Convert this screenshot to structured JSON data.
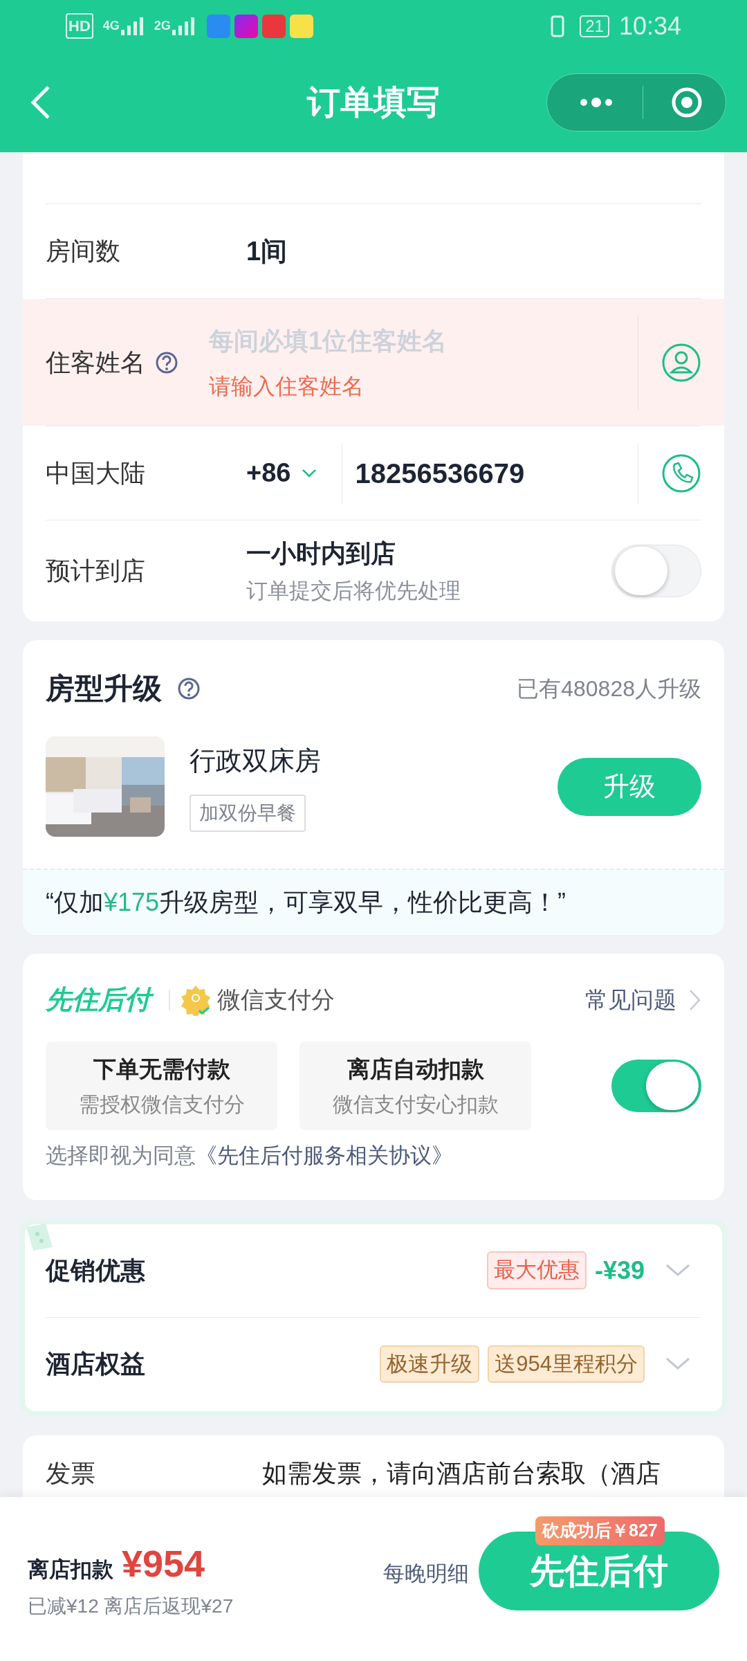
{
  "status_bar": {
    "hd": "HD",
    "network_1": "4G",
    "network_2": "2G",
    "battery": "21",
    "time": "10:34"
  },
  "nav": {
    "title": "订单填写"
  },
  "rooms": {
    "label": "房间数",
    "value": "1间"
  },
  "guest_name": {
    "label": "住客姓名",
    "placeholder": "每间必填1位住客姓名",
    "error": "请输入住客姓名",
    "invalid": true
  },
  "phone": {
    "region": "中国大陆",
    "code": "+86",
    "value": "18256536679"
  },
  "arrival": {
    "label": "预计到店",
    "value": "一小时内到店",
    "note": "订单提交后将优先处理",
    "on": false
  },
  "upgrade": {
    "title": "房型升级",
    "count": "已有480828人升级",
    "room": "行政双床房",
    "tag": "加双份早餐",
    "button": "升级",
    "pitch_before": "“仅加",
    "pitch_price": "¥175",
    "pitch_after": "升级房型，可享双早，性价比更高！”"
  },
  "pay_later": {
    "brand": "先住后付",
    "partner": "微信支付分",
    "faq": "常见问题",
    "on": true,
    "features": [
      {
        "title": "下单无需付款",
        "subtitle": "需授权微信支付分"
      },
      {
        "title": "离店自动扣款",
        "subtitle": "微信支付安心扣款"
      }
    ],
    "agreement": "选择即视为同意",
    "agreement_link": "《先住后付服务相关协议》"
  },
  "benefits": [
    {
      "label": "促销优惠",
      "tags": [
        {
          "text": "最大优惠",
          "kind": "promo"
        }
      ],
      "amount": "-¥39"
    },
    {
      "label": "酒店权益",
      "tags": [
        {
          "text": "极速升级",
          "kind": "perk"
        },
        {
          "text": "送954里程积分",
          "kind": "perk"
        }
      ]
    }
  ],
  "invoice": {
    "label": "发票",
    "text": "如需发票，请向酒店前台索取（酒店"
  },
  "footer": {
    "label": "离店扣款",
    "price": "¥954",
    "note": "已减¥12 离店后返现¥27",
    "details": "每晚明细",
    "badge": "砍成功后￥827",
    "button": "先住后付"
  }
}
